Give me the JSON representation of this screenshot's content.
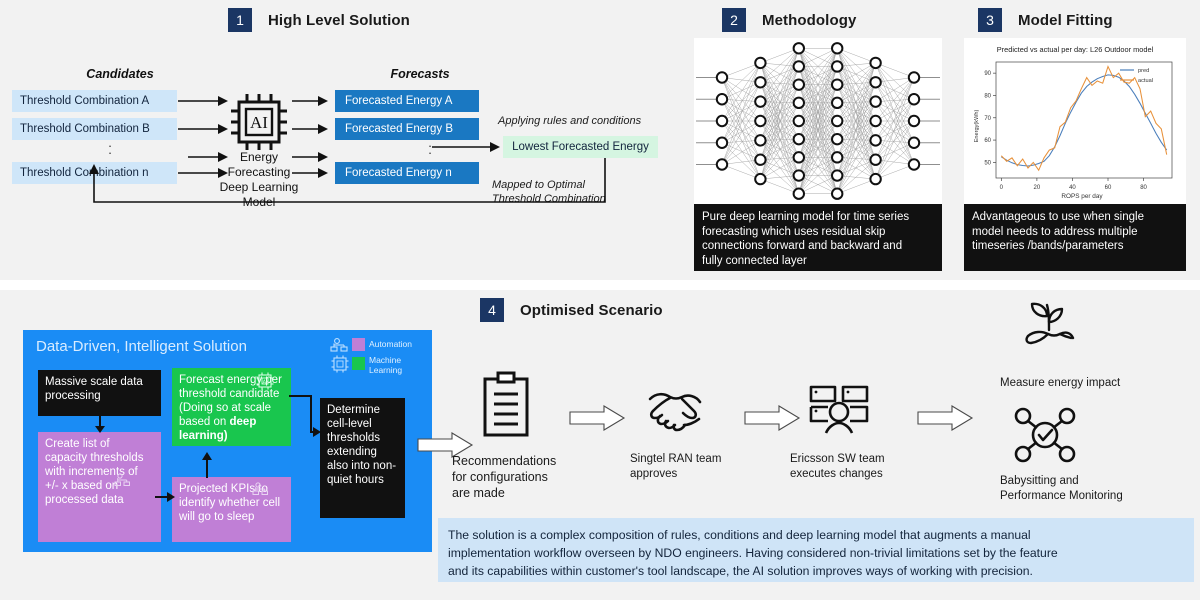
{
  "background": {
    "page": "#f2f2f2",
    "divider": "#ffffff"
  },
  "colors": {
    "badge_navy": "#1b3664",
    "candidate_blue": "#cfe6f9",
    "forecast_blue": "#1a78c2",
    "mint_green": "#d5f5e1",
    "panel_blue": "#1a8cf5",
    "node_black": "#111111",
    "node_purple": "#c07fd6",
    "node_green": "#19c64e",
    "callout_blue": "#cfe4f7"
  },
  "sections": {
    "one": {
      "number": "1",
      "title": "High Level Solution"
    },
    "two": {
      "number": "2",
      "title": "Methodology"
    },
    "three": {
      "number": "3",
      "title": "Model Fitting"
    },
    "four": {
      "number": "4",
      "title": "Optimised Scenario"
    }
  },
  "high_level_solution": {
    "candidates_label": "Candidates",
    "forecasts_label": "Forecasts",
    "candidates": [
      "Threshold Combination A",
      "Threshold Combination B",
      "Threshold Combination n"
    ],
    "forecasts": [
      "Forecasted Energy A",
      "Forecasted Energy B",
      "Forecasted Energy n"
    ],
    "model_icon": "ai-chip-icon",
    "model_label": "Energy\nForecasting\nDeep Learning\nModel",
    "model_label_lines": [
      "Energy",
      "Forecasting",
      "Deep Learning",
      "Model"
    ],
    "rules_note": "Applying rules and conditions",
    "result_box": "Lowest Forecasted Energy",
    "mapped_note_lines": [
      "Mapped to Optimal",
      "Threshold Combination"
    ],
    "ellipsis": "·"
  },
  "methodology": {
    "diagram": "neural-network-diagram",
    "caption": "Pure deep learning model for time series forecasting which uses residual skip connections forward and backward and fully connected layer",
    "caption_lines": [
      "Pure deep learning model for time series",
      "forecasting which uses residual skip",
      "connections forward and backward and",
      "fully connected layer"
    ],
    "layers": [
      5,
      7,
      9,
      9,
      7,
      5
    ]
  },
  "model_fitting": {
    "caption": "Advantageous to use when single model needs to address multiple timeseries /bands/parameters",
    "caption_lines": [
      "Advantageous to use when single",
      "model needs to address multiple",
      "timeseries  /bands/parameters"
    ]
  },
  "chart_data": {
    "type": "line",
    "title": "Predicted vs actual per day: L26 Outdoor model",
    "xlabel": "ROPS per day",
    "ylabel": "Energy(kWh)",
    "xlim": [
      -3,
      96
    ],
    "ylim": [
      43,
      95
    ],
    "xticks": [
      0,
      20,
      40,
      60,
      80
    ],
    "yticks": [
      50,
      60,
      70,
      80,
      90
    ],
    "grid": false,
    "legend_position": "upper right",
    "series": [
      {
        "name": "pred",
        "color": "#4a7ebb",
        "x": [
          0,
          3,
          6,
          9,
          12,
          15,
          18,
          21,
          24,
          27,
          30,
          33,
          36,
          39,
          42,
          45,
          48,
          51,
          54,
          57,
          60,
          63,
          66,
          69,
          72,
          75,
          78,
          81,
          84,
          87,
          90,
          93
        ],
        "values": [
          52.5,
          51.0,
          49.8,
          49.0,
          48.6,
          48.4,
          48.8,
          49.5,
          50.5,
          53.0,
          57.0,
          62.0,
          67.5,
          72.5,
          77.0,
          81.0,
          84.0,
          86.0,
          87.5,
          88.5,
          89.2,
          89.0,
          88.2,
          86.5,
          84.0,
          80.5,
          76.5,
          72.0,
          67.5,
          63.0,
          59.0,
          55.5
        ]
      },
      {
        "name": "actual",
        "color": "#e8913a",
        "x": [
          0,
          3,
          6,
          9,
          12,
          15,
          18,
          21,
          24,
          27,
          30,
          33,
          36,
          39,
          42,
          45,
          48,
          51,
          54,
          57,
          60,
          63,
          66,
          69,
          72,
          75,
          78,
          81,
          84,
          87,
          90,
          93
        ],
        "values": [
          53.0,
          50.5,
          52.0,
          48.5,
          51.5,
          47.5,
          50.0,
          46.5,
          52.0,
          55.5,
          56.5,
          66.0,
          68.0,
          74.5,
          77.5,
          83.0,
          88.0,
          84.5,
          86.5,
          85.5,
          93.0,
          88.0,
          90.0,
          86.0,
          85.5,
          88.0,
          83.0,
          70.5,
          73.0,
          67.5,
          65.0,
          53.5
        ]
      }
    ],
    "legend": [
      "pred",
      "actual"
    ]
  },
  "optimised_scenario": {
    "panel_title": "Data-Driven, Intelligent Solution",
    "legend": [
      {
        "icon": "automation-gear-icon",
        "swatch": "#c07fd6",
        "label": "Automation",
        "label_lines": [
          "Automation"
        ]
      },
      {
        "icon": "ml-chip-icon",
        "swatch": "#19c64e",
        "label": "Machine Learning",
        "label_lines": [
          "Machine",
          "Learning"
        ]
      }
    ],
    "nodes": {
      "massive": "Massive scale data processing",
      "create_list": "Create list of capacity thresholds with increments of +/- x based on processed data",
      "forecast": "Forecast energy per threshold candidate (Doing so at scale based on deep learning)",
      "forecast_bold_tail": "deep learning)",
      "projected": "Projected KPIs to identify whether cell will go to sleep",
      "determine": "Determine cell-level thresholds extending also into non-quiet hours"
    },
    "workflow": [
      {
        "icon": "clipboard-icon",
        "caption": "Recommendations for configurations are made",
        "caption_lines": [
          "Recommendations",
          "for configurations",
          "are made"
        ]
      },
      {
        "icon": "handshake-icon",
        "caption": "Singtel RAN team approves",
        "caption_lines": [
          "Singtel RAN team",
          "approves"
        ]
      },
      {
        "icon": "team-screens-icon",
        "caption": "Ericsson SW team executes changes",
        "caption_lines": [
          "Ericsson SW team",
          "executes changes"
        ]
      }
    ],
    "outcomes": [
      {
        "icon": "plant-in-hand-icon",
        "caption": "Measure energy impact",
        "caption_lines": [
          "Measure energy impact"
        ]
      },
      {
        "icon": "monitoring-check-icon",
        "caption": "Babysitting and Performance Monitoring",
        "caption_lines": [
          "Babysitting and",
          "Performance Monitoring"
        ]
      }
    ],
    "callout": "The solution is a complex composition of rules, conditions and deep learning model that augments a manual implementation workflow overseen by NDO engineers. Having considered non-trivial limitations set by the feature and its capabilities within customer's tool landscape, the AI solution improves ways of working with precision.",
    "callout_lines": [
      "The solution is a complex composition of rules, conditions and deep learning model that augments a manual",
      "implementation workflow overseen by NDO engineers. Having considered non-trivial limitations set by the feature",
      "and its capabilities within customer's tool landscape, the AI solution improves ways of working with precision."
    ]
  }
}
